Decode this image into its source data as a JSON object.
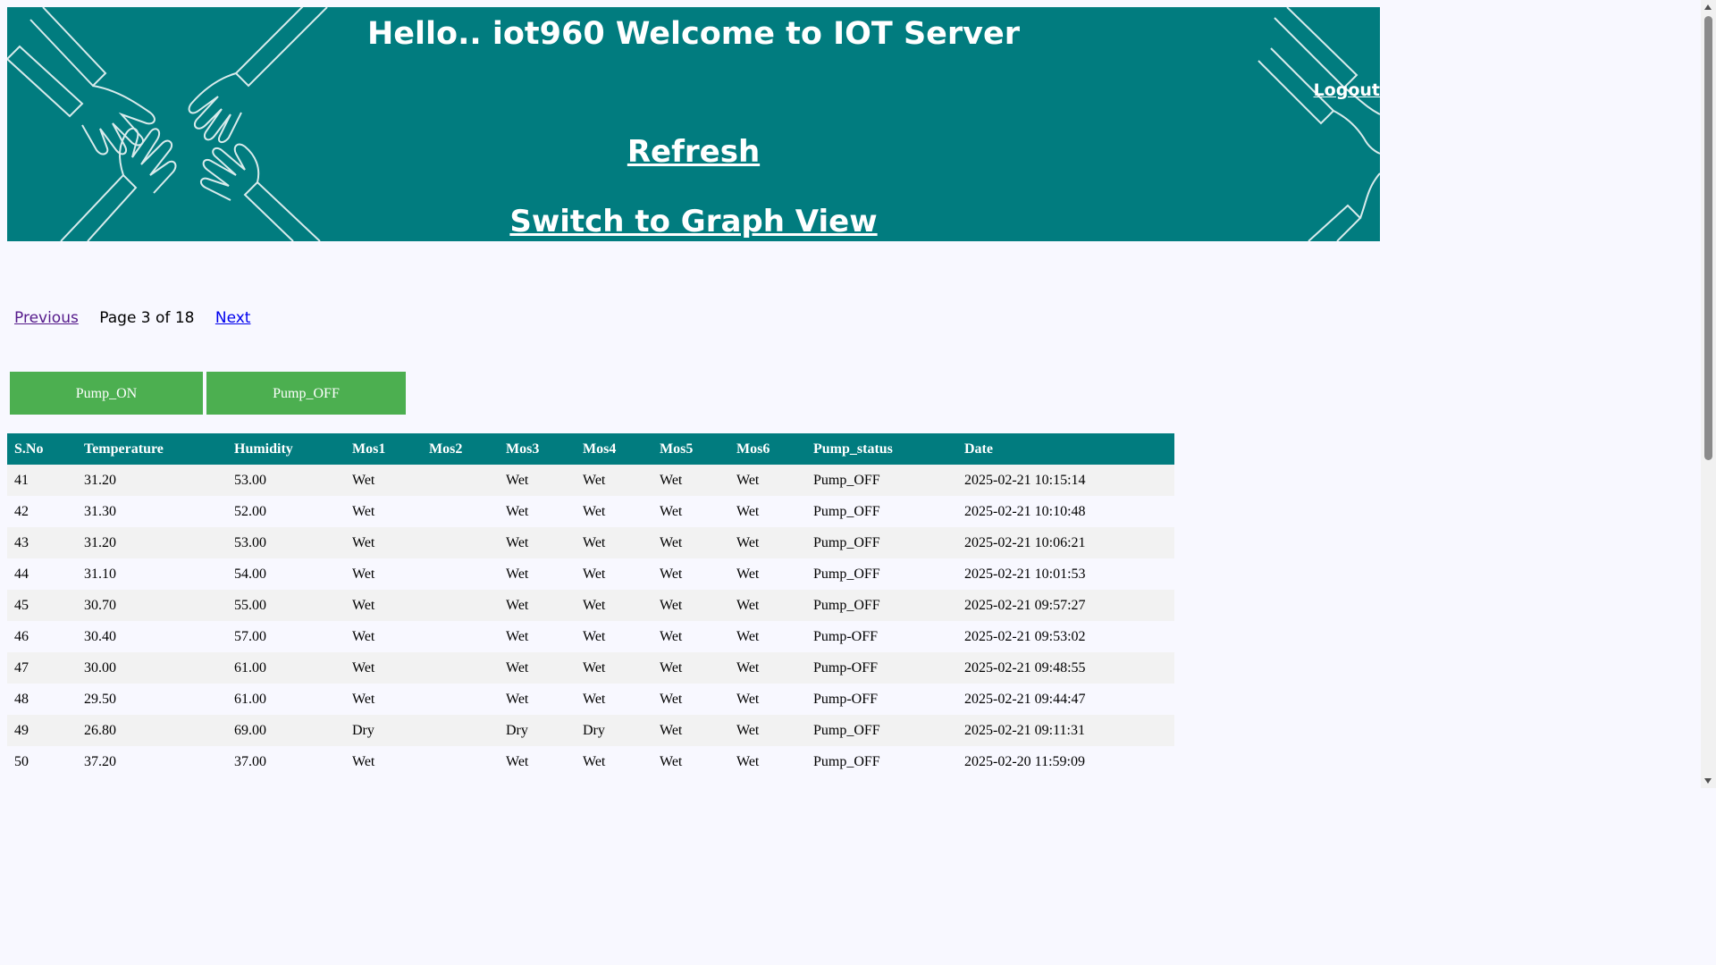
{
  "header": {
    "welcome": "Hello.. iot960 Welcome to IOT Server",
    "logout": "Logout",
    "refresh": "Refresh",
    "graph_view": "Switch to Graph View"
  },
  "pager": {
    "previous": "Previous",
    "page_info": "Page 3 of 18",
    "next": "Next"
  },
  "pump": {
    "on_label": "Pump_ON",
    "off_label": "Pump_OFF"
  },
  "table": {
    "columns": [
      "S.No",
      "Temperature",
      "Humidity",
      "Mos1",
      "Mos2",
      "Mos3",
      "Mos4",
      "Mos5",
      "Mos6",
      "Pump_status",
      "Date"
    ],
    "rows": [
      [
        "41",
        "31.20",
        "53.00",
        "Wet",
        "",
        "Wet",
        "Wet",
        "Wet",
        "Wet",
        "Pump_OFF",
        "2025-02-21 10:15:14"
      ],
      [
        "42",
        "31.30",
        "52.00",
        "Wet",
        "",
        "Wet",
        "Wet",
        "Wet",
        "Wet",
        "Pump_OFF",
        "2025-02-21 10:10:48"
      ],
      [
        "43",
        "31.20",
        "53.00",
        "Wet",
        "",
        "Wet",
        "Wet",
        "Wet",
        "Wet",
        "Pump_OFF",
        "2025-02-21 10:06:21"
      ],
      [
        "44",
        "31.10",
        "54.00",
        "Wet",
        "",
        "Wet",
        "Wet",
        "Wet",
        "Wet",
        "Pump_OFF",
        "2025-02-21 10:01:53"
      ],
      [
        "45",
        "30.70",
        "55.00",
        "Wet",
        "",
        "Wet",
        "Wet",
        "Wet",
        "Wet",
        "Pump_OFF",
        "2025-02-21 09:57:27"
      ],
      [
        "46",
        "30.40",
        "57.00",
        "Wet",
        "",
        "Wet",
        "Wet",
        "Wet",
        "Wet",
        "Pump-OFF",
        "2025-02-21 09:53:02"
      ],
      [
        "47",
        "30.00",
        "61.00",
        "Wet",
        "",
        "Wet",
        "Wet",
        "Wet",
        "Wet",
        "Pump-OFF",
        "2025-02-21 09:48:55"
      ],
      [
        "48",
        "29.50",
        "61.00",
        "Wet",
        "",
        "Wet",
        "Wet",
        "Wet",
        "Wet",
        "Pump-OFF",
        "2025-02-21 09:44:47"
      ],
      [
        "49",
        "26.80",
        "69.00",
        "Dry",
        "",
        "Dry",
        "Dry",
        "Wet",
        "Wet",
        "Pump_OFF",
        "2025-02-21 09:11:31"
      ],
      [
        "50",
        "37.20",
        "37.00",
        "Wet",
        "",
        "Wet",
        "Wet",
        "Wet",
        "Wet",
        "Pump_OFF",
        "2025-02-20 11:59:09"
      ]
    ]
  },
  "colors": {
    "banner": "#017c7f",
    "button": "#4caf50",
    "page_bg": "#f8f8ff",
    "row_alt": "#f2f2f2"
  },
  "icons": {
    "banner_decoration": "hands-handshake-illustration"
  }
}
